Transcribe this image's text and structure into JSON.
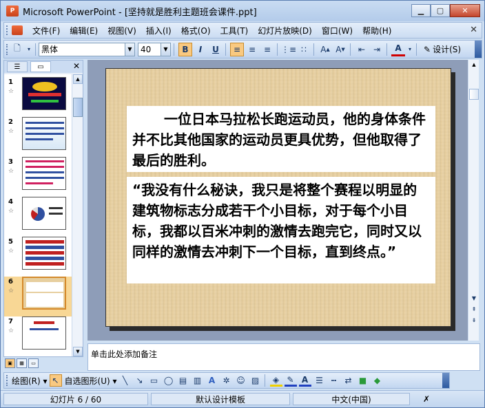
{
  "window": {
    "title": "Microsoft PowerPoint - [坚持就是胜利主题班会课件.ppt]",
    "app_icon_text": "P"
  },
  "menu": {
    "items": [
      "文件(F)",
      "编辑(E)",
      "视图(V)",
      "插入(I)",
      "格式(O)",
      "工具(T)",
      "幻灯片放映(D)",
      "窗口(W)",
      "帮助(H)"
    ]
  },
  "toolbar": {
    "font_name": "黑体",
    "font_size": "40",
    "bold": "B",
    "italic": "I",
    "underline": "U",
    "design_label": "设计(S)"
  },
  "slides_pane": {
    "slides": [
      {
        "number": "1"
      },
      {
        "number": "2"
      },
      {
        "number": "3"
      },
      {
        "number": "4"
      },
      {
        "number": "5"
      },
      {
        "number": "6"
      },
      {
        "number": "7"
      }
    ],
    "selected": 6
  },
  "slide": {
    "paragraph1": "一位日本马拉松长跑运动员，他的身体条件并不比其他国家的运动员更具优势，但他取得了最后的胜利。",
    "paragraph2": "“我没有什么秘诀，我只是将整个赛程以明显的建筑物标志分成若干个小目标，对于每个小目标，我都以百米冲刺的激情去跑完它，同时又以同样的激情去冲刺下一个目标，直到终点。”"
  },
  "notes": {
    "placeholder": "单击此处添加备注"
  },
  "drawbar": {
    "draw_label": "绘图(R)",
    "autoshapes_label": "自选图形(U)"
  },
  "statusbar": {
    "slide_position": "幻灯片 6 / 60",
    "template": "默认设计模板",
    "language": "中文(中国)"
  },
  "colors": {
    "slide_background": "#e7cf9f",
    "selection": "#f9c980",
    "chrome": "#cfe0f3"
  }
}
